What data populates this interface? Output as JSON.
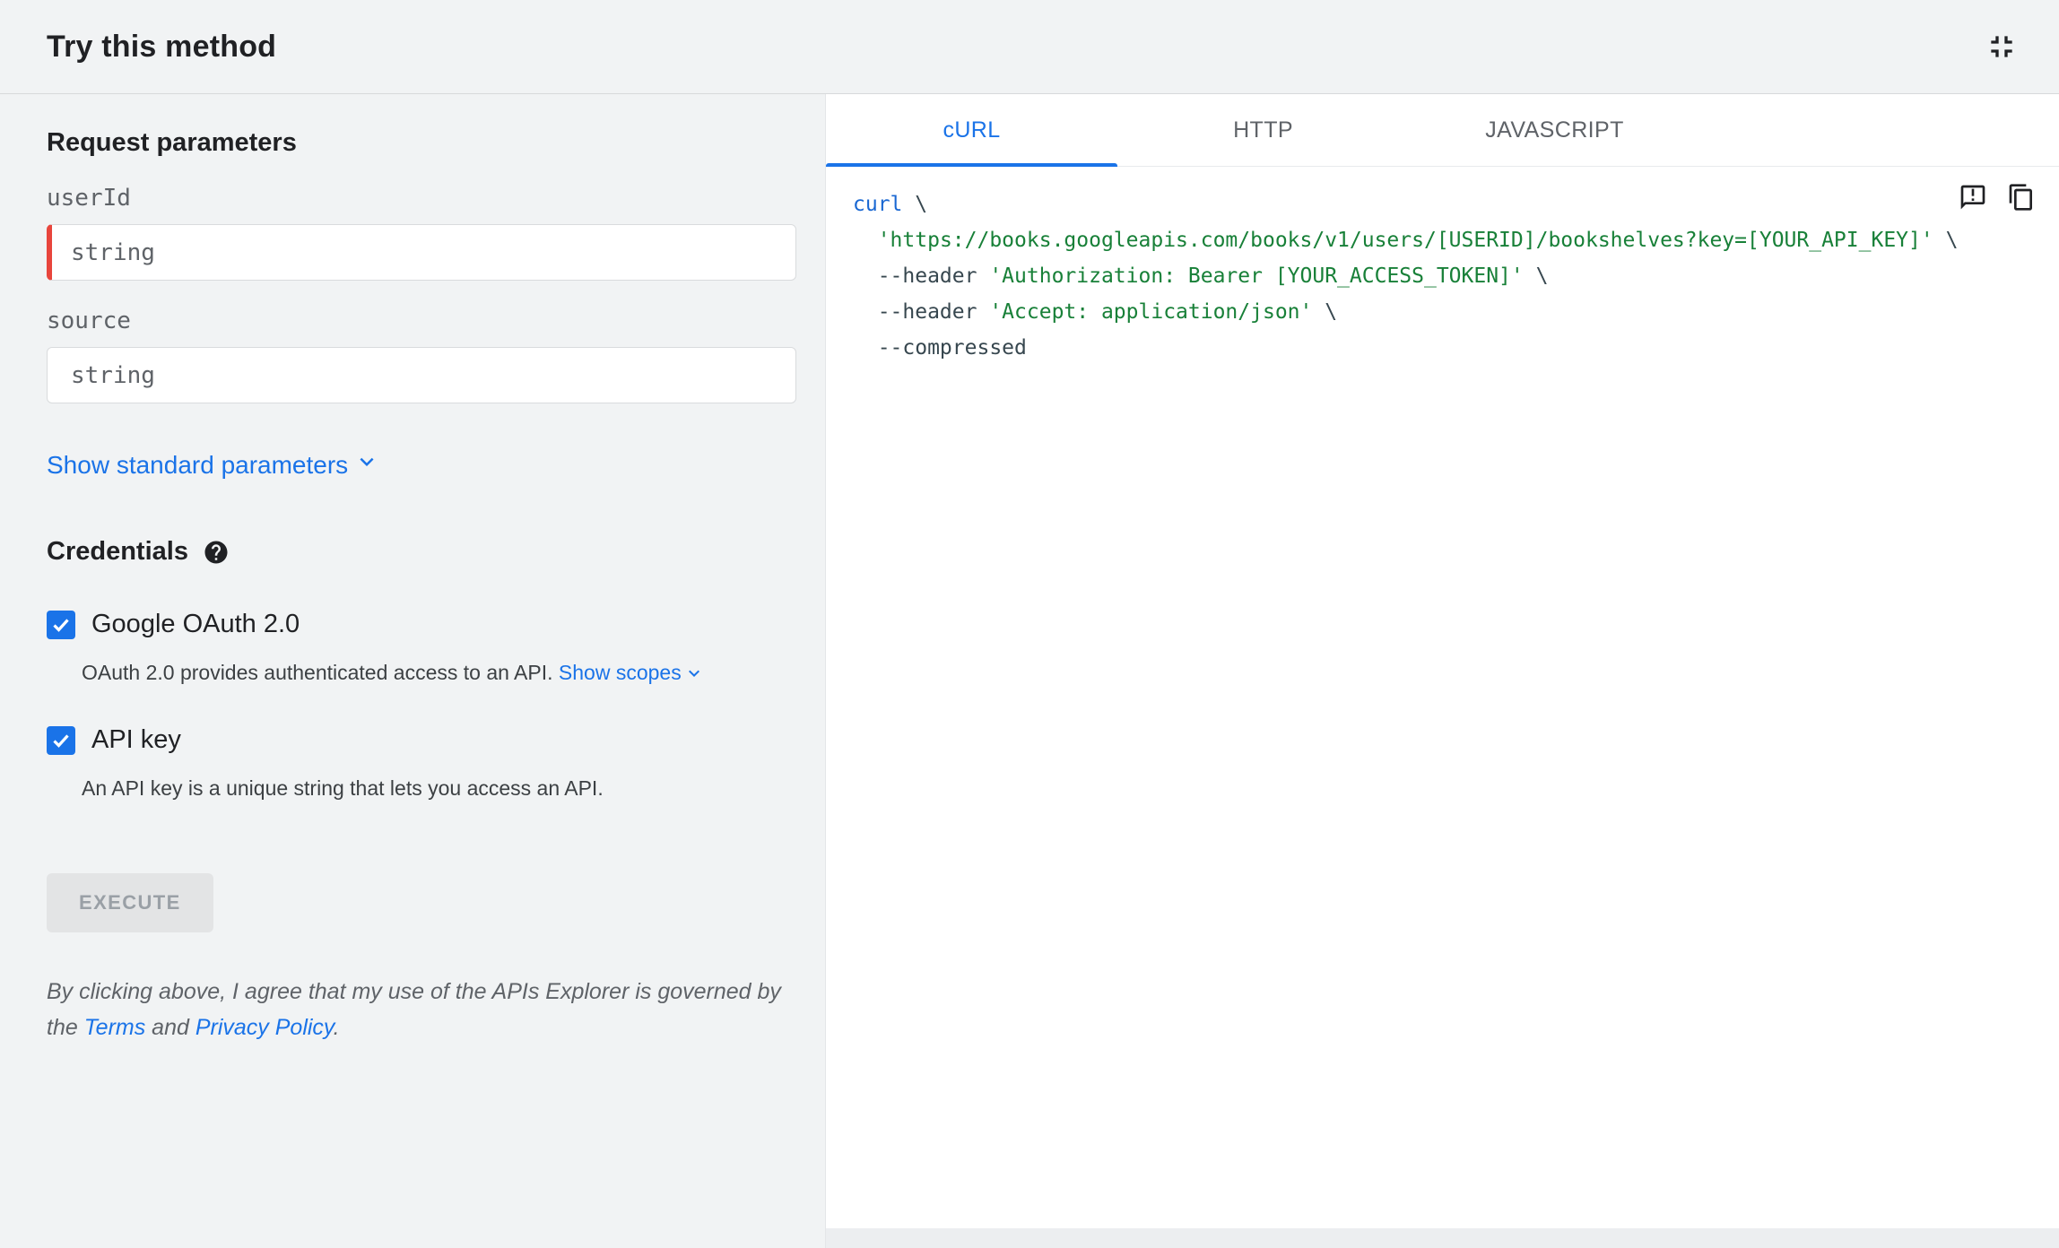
{
  "colors": {
    "accent_blue": "#1a73e8",
    "required_red": "#e8453c",
    "panel_gray": "#f1f3f4",
    "code_keyword_blue": "#1967d2",
    "code_string_green": "#188038",
    "code_plain": "#37474f"
  },
  "icons": {
    "header_right": "fullscreen-exit-icon",
    "credentials": "help-icon",
    "links": "chevron-down-icon",
    "code_area": [
      "feedback-icon",
      "copy-icon"
    ]
  },
  "header": {
    "title": "Try this method"
  },
  "left": {
    "request_title": "Request parameters",
    "params": [
      {
        "name": "userId",
        "placeholder": "string",
        "value": "",
        "required": true
      },
      {
        "name": "source",
        "placeholder": "string",
        "value": "",
        "required": false
      }
    ],
    "show_standard_label": "Show standard parameters",
    "credentials_title": "Credentials",
    "oauth": {
      "label": "Google OAuth 2.0",
      "checked": true,
      "description": "OAuth 2.0 provides authenticated access to an API. ",
      "show_scopes_label": "Show scopes"
    },
    "api_key": {
      "label": "API key",
      "checked": true,
      "description": "An API key is a unique string that lets you access an API."
    },
    "execute_label": "EXECUTE",
    "disclaimer": {
      "text_start": "By clicking above, I agree that my use of the APIs Explorer is governed by the ",
      "terms_link": "Terms",
      "text_middle": " and ",
      "privacy_link": "Privacy Policy",
      "text_end": "."
    }
  },
  "right": {
    "tabs": [
      {
        "label": "cURL",
        "active": true
      },
      {
        "label": "HTTP",
        "active": false
      },
      {
        "label": "JAVASCRIPT",
        "active": false
      }
    ],
    "code_lines": [
      [
        {
          "t": "curl",
          "c": "kw"
        },
        {
          "t": " \\",
          "c": "pln"
        }
      ],
      [
        {
          "t": "  ",
          "c": "pln"
        },
        {
          "t": "'https://books.googleapis.com/books/v1/users/[USERID]/bookshelves?key=[YOUR_API_KEY]'",
          "c": "str"
        },
        {
          "t": " \\",
          "c": "pln"
        }
      ],
      [
        {
          "t": "  --header ",
          "c": "pln"
        },
        {
          "t": "'Authorization: Bearer [YOUR_ACCESS_TOKEN]'",
          "c": "str"
        },
        {
          "t": " \\",
          "c": "pln"
        }
      ],
      [
        {
          "t": "  --header ",
          "c": "pln"
        },
        {
          "t": "'Accept: application/json'",
          "c": "str"
        },
        {
          "t": " \\",
          "c": "pln"
        }
      ],
      [
        {
          "t": "  --compressed",
          "c": "pln"
        }
      ]
    ]
  }
}
